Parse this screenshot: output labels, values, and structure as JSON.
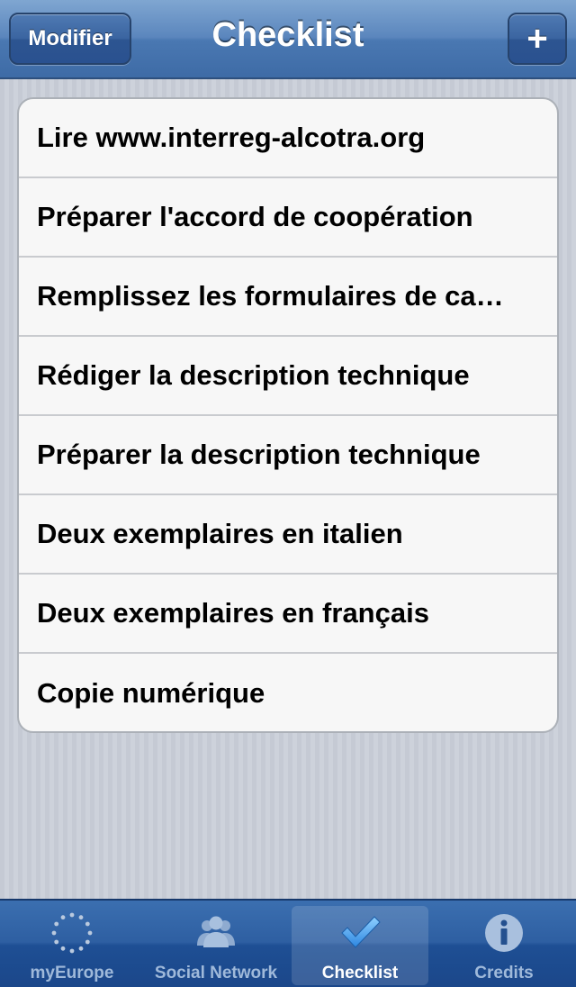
{
  "navbar": {
    "title": "Checklist",
    "left_button": "Modifier",
    "right_button": "+"
  },
  "checklist": {
    "items": [
      {
        "label": "Lire www.interreg-alcotra.org"
      },
      {
        "label": "Préparer l'accord de coopération"
      },
      {
        "label": "Remplissez les formulaires de candidature"
      },
      {
        "label": "Rédiger la description technique"
      },
      {
        "label": "Préparer la description technique"
      },
      {
        "label": "Deux exemplaires en italien"
      },
      {
        "label": "Deux exemplaires en français"
      },
      {
        "label": "Copie numérique"
      }
    ]
  },
  "tabbar": {
    "tabs": [
      {
        "label": "myEurope",
        "icon": "eu-stars-icon",
        "selected": false
      },
      {
        "label": "Social Network",
        "icon": "people-icon",
        "selected": false
      },
      {
        "label": "Checklist",
        "icon": "checkmark-icon",
        "selected": true
      },
      {
        "label": "Credits",
        "icon": "info-icon",
        "selected": false
      }
    ]
  }
}
